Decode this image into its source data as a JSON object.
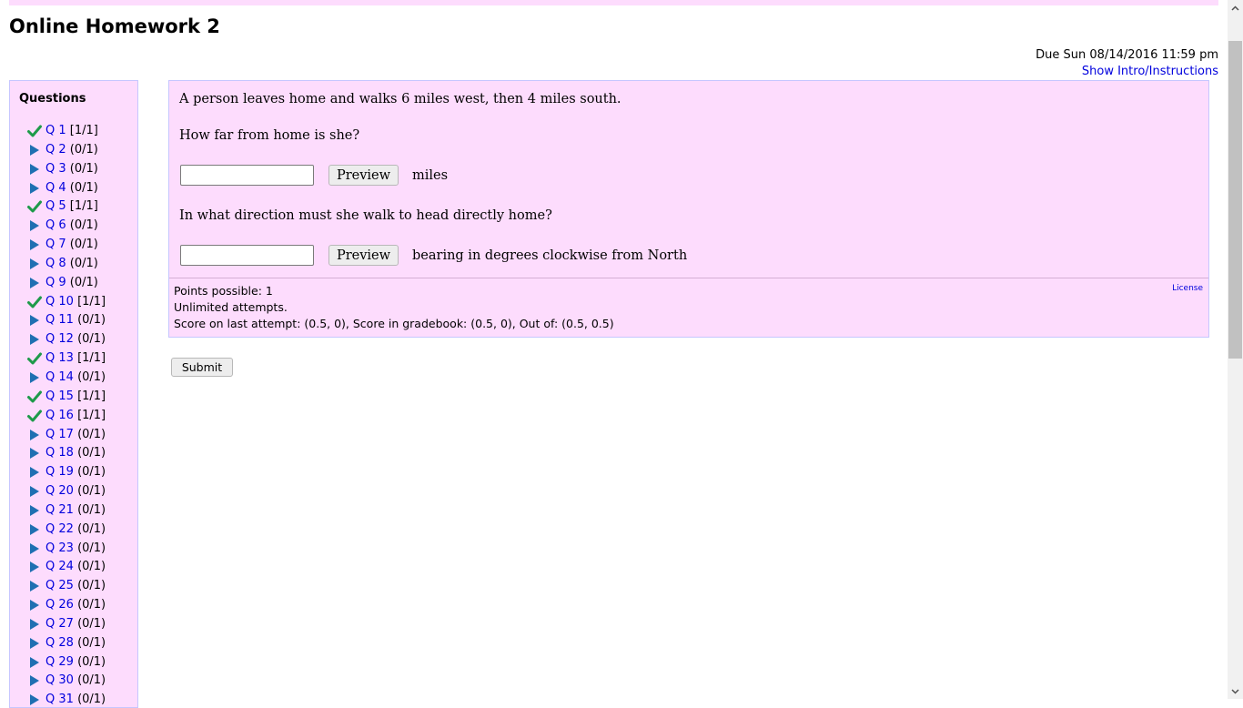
{
  "page": {
    "title": "Online Homework 2",
    "due": "Due Sun 08/14/2016 11:59 pm",
    "show_intro": "Show Intro/Instructions"
  },
  "sidebar": {
    "title": "Questions",
    "questions": [
      {
        "label": "Q 1",
        "score": "[1/1]",
        "status": "correct"
      },
      {
        "label": "Q 2",
        "score": "(0/1)",
        "status": "pending"
      },
      {
        "label": "Q 3",
        "score": "(0/1)",
        "status": "pending"
      },
      {
        "label": "Q 4",
        "score": "(0/1)",
        "status": "pending"
      },
      {
        "label": "Q 5",
        "score": "[1/1]",
        "status": "correct"
      },
      {
        "label": "Q 6",
        "score": "(0/1)",
        "status": "pending"
      },
      {
        "label": "Q 7",
        "score": "(0/1)",
        "status": "pending"
      },
      {
        "label": "Q 8",
        "score": "(0/1)",
        "status": "pending"
      },
      {
        "label": "Q 9",
        "score": "(0/1)",
        "status": "pending"
      },
      {
        "label": "Q 10",
        "score": "[1/1]",
        "status": "correct"
      },
      {
        "label": "Q 11",
        "score": "(0/1)",
        "status": "pending"
      },
      {
        "label": "Q 12",
        "score": "(0/1)",
        "status": "pending"
      },
      {
        "label": "Q 13",
        "score": "[1/1]",
        "status": "correct"
      },
      {
        "label": "Q 14",
        "score": "(0/1)",
        "status": "pending"
      },
      {
        "label": "Q 15",
        "score": "[1/1]",
        "status": "correct"
      },
      {
        "label": "Q 16",
        "score": "[1/1]",
        "status": "correct"
      },
      {
        "label": "Q 17",
        "score": "(0/1)",
        "status": "pending"
      },
      {
        "label": "Q 18",
        "score": "(0/1)",
        "status": "pending"
      },
      {
        "label": "Q 19",
        "score": "(0/1)",
        "status": "pending"
      },
      {
        "label": "Q 20",
        "score": "(0/1)",
        "status": "pending"
      },
      {
        "label": "Q 21",
        "score": "(0/1)",
        "status": "pending"
      },
      {
        "label": "Q 22",
        "score": "(0/1)",
        "status": "pending"
      },
      {
        "label": "Q 23",
        "score": "(0/1)",
        "status": "pending"
      },
      {
        "label": "Q 24",
        "score": "(0/1)",
        "status": "pending"
      },
      {
        "label": "Q 25",
        "score": "(0/1)",
        "status": "pending"
      },
      {
        "label": "Q 26",
        "score": "(0/1)",
        "status": "pending"
      },
      {
        "label": "Q 27",
        "score": "(0/1)",
        "status": "pending"
      },
      {
        "label": "Q 28",
        "score": "(0/1)",
        "status": "pending"
      },
      {
        "label": "Q 29",
        "score": "(0/1)",
        "status": "pending"
      },
      {
        "label": "Q 30",
        "score": "(0/1)",
        "status": "pending"
      },
      {
        "label": "Q 31",
        "score": "(0/1)",
        "status": "pending"
      }
    ]
  },
  "question": {
    "prompt": "A person leaves home and walks 6 miles west, then 4 miles south.",
    "part1_text": "How far from home is she?",
    "part1_value": "",
    "part1_unit": "miles",
    "part2_text": "In what direction must she walk to head directly home?",
    "part2_value": "",
    "part2_unit": "bearing in degrees clockwise from North",
    "preview_label": "Preview",
    "points": "Points possible: 1",
    "attempts": "Unlimited attempts.",
    "score_line": "Score on last attempt: (0.5, 0), Score in gradebook: (0.5, 0), Out of: (0.5, 0.5)",
    "license": "License"
  },
  "actions": {
    "submit": "Submit"
  },
  "colors": {
    "panel_bg": "#fddcfd",
    "link": "#0000dd",
    "check": "#1e9a4a",
    "arrow": "#1f6fb2"
  }
}
